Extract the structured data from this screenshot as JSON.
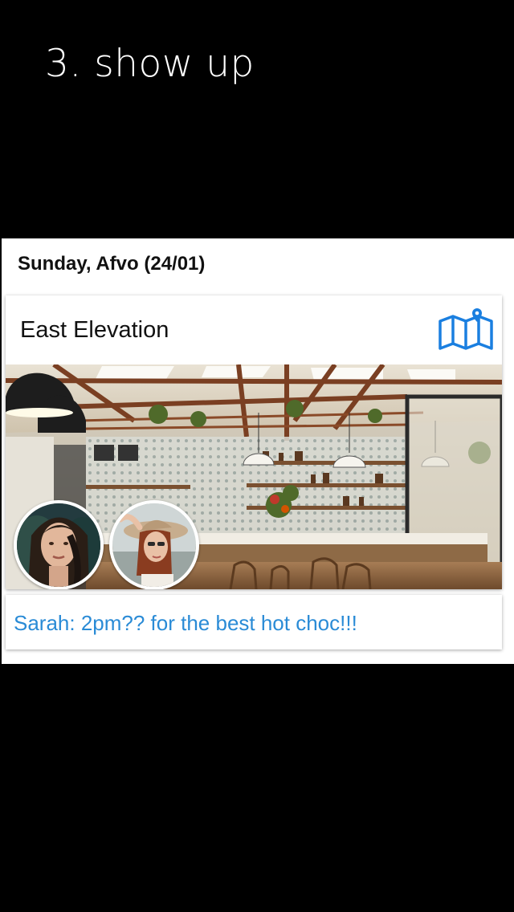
{
  "step": {
    "title": "3. show up"
  },
  "event": {
    "date_heading": "Sunday, Afvo (24/01)",
    "venue": "East Elevation",
    "map_icon": "map-pin-icon",
    "photo": "cafe-interior-photo",
    "attendees": [
      {
        "avatar": "avatar-dark-hair-woman"
      },
      {
        "avatar": "avatar-hat-woman"
      }
    ],
    "message": "Sarah: 2pm?? for the best hot choc!!!"
  },
  "colors": {
    "background": "#000000",
    "accent": "#2a8bd6",
    "map_icon": "#1a7fe0"
  }
}
